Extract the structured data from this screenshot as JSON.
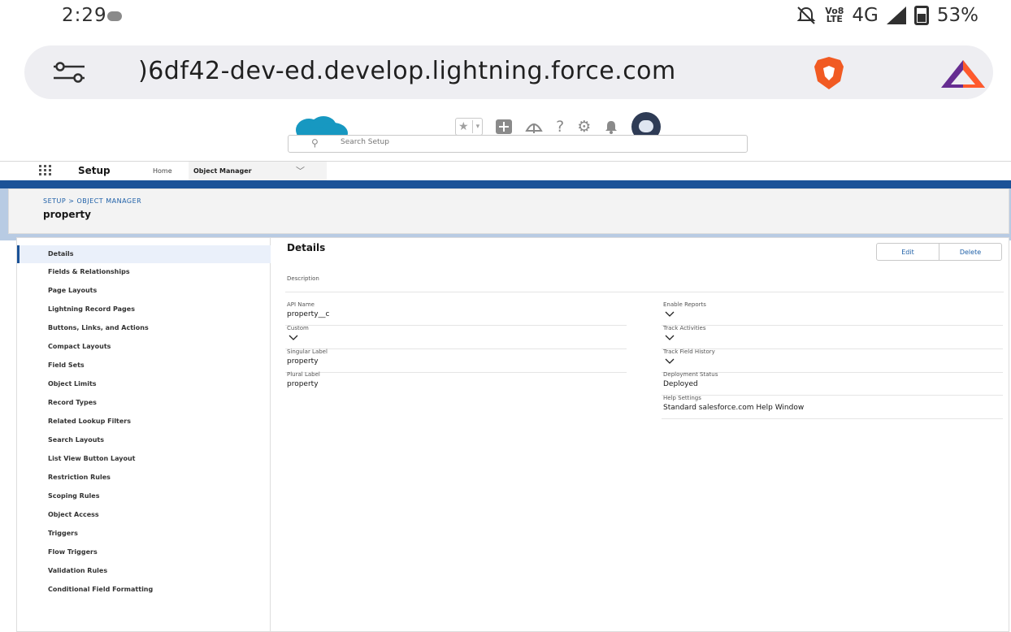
{
  "status_bar": {
    "time": "2:29",
    "network": "4G",
    "volte": "Vo8\nLTE",
    "battery": "53%"
  },
  "browser": {
    "url": "⁠)6df42-dev-ed.develop.lightning.force.com"
  },
  "search": {
    "placeholder": "Search Setup"
  },
  "app_nav": {
    "app_name": "Setup",
    "home": "Home",
    "object_manager": "Object Manager"
  },
  "page_header": {
    "breadcrumb": "SETUP > OBJECT MANAGER",
    "title": "property"
  },
  "sidebar": {
    "items": [
      "Details",
      "Fields & Relationships",
      "Page Layouts",
      "Lightning Record Pages",
      "Buttons, Links, and Actions",
      "Compact Layouts",
      "Field Sets",
      "Object Limits",
      "Record Types",
      "Related Lookup Filters",
      "Search Layouts",
      "List View Button Layout",
      "Restriction Rules",
      "Scoping Rules",
      "Object Access",
      "Triggers",
      "Flow Triggers",
      "Validation Rules",
      "Conditional Field Formatting"
    ]
  },
  "details": {
    "title": "Details",
    "edit_label": "Edit",
    "delete_label": "Delete",
    "description_label": "Description",
    "left_fields": [
      {
        "label": "API Name",
        "value": "property__c"
      },
      {
        "label": "Custom",
        "checked": true
      },
      {
        "label": "Singular Label",
        "value": "property"
      },
      {
        "label": "Plural Label",
        "value": "property"
      }
    ],
    "right_fields": [
      {
        "label": "Enable Reports",
        "checked": true
      },
      {
        "label": "Track Activities",
        "checked": true
      },
      {
        "label": "Track Field History",
        "checked": true
      },
      {
        "label": "Deployment Status",
        "value": "Deployed"
      },
      {
        "label": "Help Settings",
        "value": "Standard salesforce.com Help Window"
      }
    ]
  },
  "colors": {
    "brand_blue": "#1b5297",
    "link_blue": "#2061a8",
    "salesforce_cloud": "#1798c1",
    "brave_orange": "#f15a22"
  }
}
